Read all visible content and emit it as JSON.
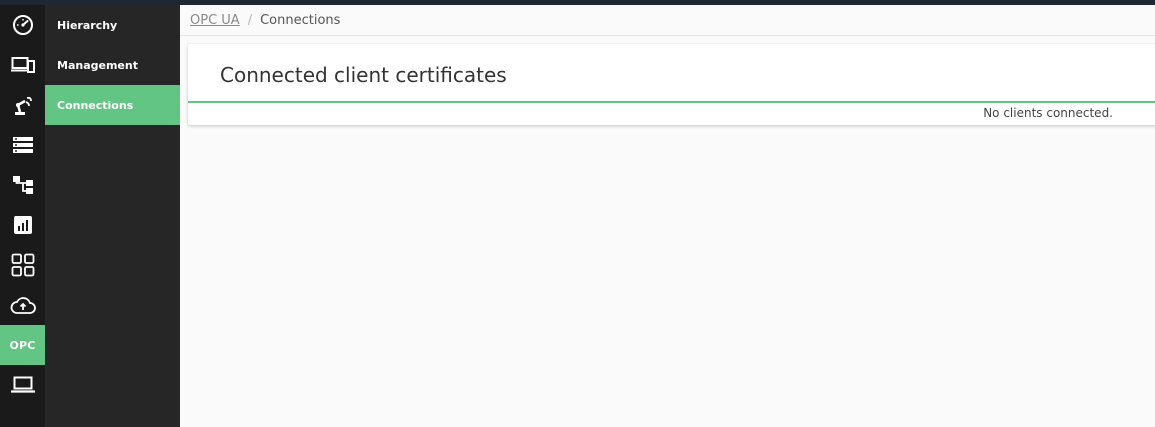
{
  "colors": {
    "accent": "#62c584",
    "rail_bg": "#1a1a1a",
    "subnav_bg": "#262626",
    "top_strip": "#1f2733"
  },
  "rail": {
    "items": [
      {
        "icon": "speedometer-icon"
      },
      {
        "icon": "devices-icon"
      },
      {
        "icon": "robot-arm-icon"
      },
      {
        "icon": "server-list-icon"
      },
      {
        "icon": "hierarchy-tree-icon"
      },
      {
        "icon": "bar-chart-icon"
      },
      {
        "icon": "apps-grid-icon"
      },
      {
        "icon": "cloud-upload-icon"
      },
      {
        "icon": "opc-text-icon",
        "label": "OPC",
        "active": true
      },
      {
        "icon": "laptop-icon"
      }
    ]
  },
  "subnav": {
    "items": [
      {
        "label": "Hierarchy"
      },
      {
        "label": "Management"
      },
      {
        "label": "Connections",
        "active": true
      }
    ]
  },
  "breadcrumb": {
    "parent": "OPC UA",
    "separator": "/",
    "current": "Connections"
  },
  "card": {
    "title": "Connected client certificates",
    "empty_message": "No clients connected."
  }
}
